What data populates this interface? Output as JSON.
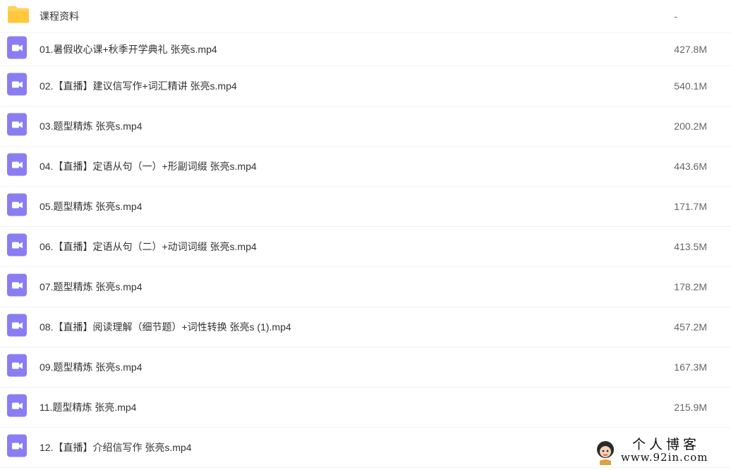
{
  "colors": {
    "folder": "#ffd15c",
    "video": "#8a7df2",
    "divider": "#f1f2f4"
  },
  "folder": {
    "name": "课程资料",
    "size": "-",
    "icon": "folder-icon"
  },
  "files": [
    {
      "name": "01.暑假收心课+秋季开学典礼 张亮s.mp4",
      "size": "427.8M",
      "icon": "video-file-icon"
    },
    {
      "name": "02.【直播】建议信写作+词汇精讲 张亮s.mp4",
      "size": "540.1M",
      "icon": "video-file-icon"
    },
    {
      "name": "03.题型精炼 张亮s.mp4",
      "size": "200.2M",
      "icon": "video-file-icon"
    },
    {
      "name": "04.【直播】定语从句（一）+形副词缀 张亮s.mp4",
      "size": "443.6M",
      "icon": "video-file-icon"
    },
    {
      "name": "05.题型精炼 张亮s.mp4",
      "size": "171.7M",
      "icon": "video-file-icon"
    },
    {
      "name": "06.【直播】定语从句（二）+动词词缀 张亮s.mp4",
      "size": "413.5M",
      "icon": "video-file-icon"
    },
    {
      "name": "07.题型精炼 张亮s.mp4",
      "size": "178.2M",
      "icon": "video-file-icon"
    },
    {
      "name": "08.【直播】阅读理解（细节题）+词性转换 张亮s (1).mp4",
      "size": "457.2M",
      "icon": "video-file-icon"
    },
    {
      "name": "09.题型精炼 张亮s.mp4",
      "size": "167.3M",
      "icon": "video-file-icon"
    },
    {
      "name": "11.题型精炼 张亮.mp4",
      "size": "215.9M",
      "icon": "video-file-icon"
    },
    {
      "name": "12.【直播】介绍信写作 张亮s.mp4",
      "size": "",
      "icon": "video-file-icon"
    }
  ],
  "watermark": {
    "title": "个人博客",
    "url": "www.92in.com"
  }
}
